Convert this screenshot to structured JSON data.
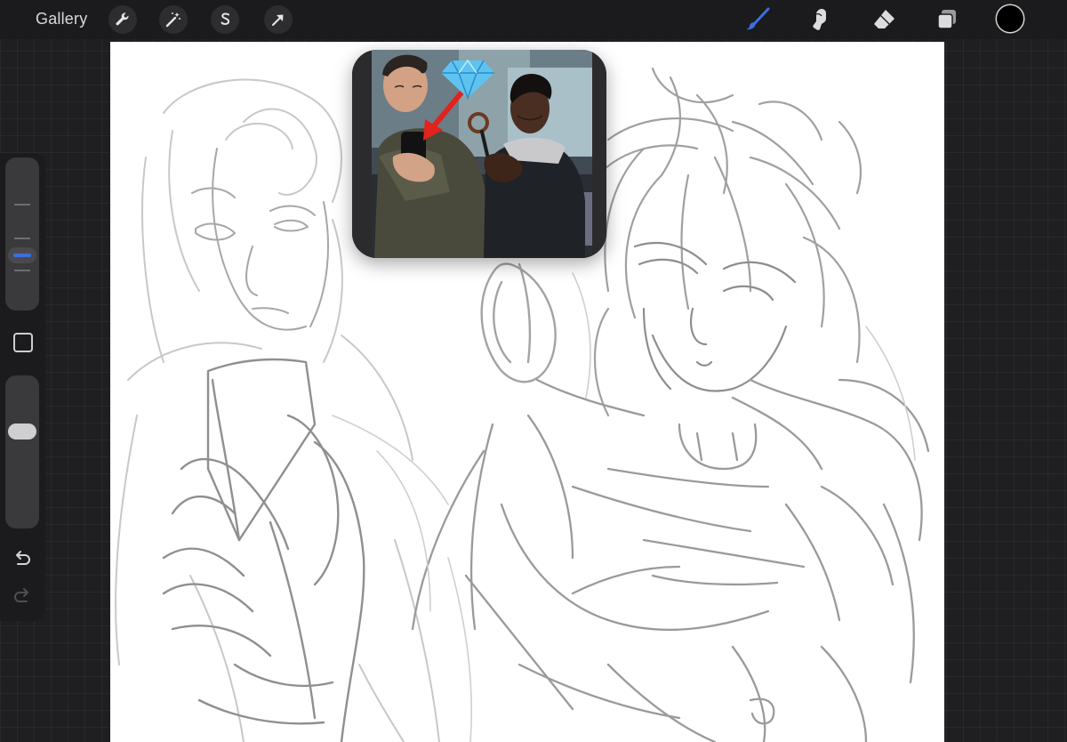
{
  "topbar": {
    "gallery_label": "Gallery",
    "left_tools": [
      {
        "name": "actions-wrench-icon"
      },
      {
        "name": "adjustments-wand-icon"
      },
      {
        "name": "selection-s-icon"
      },
      {
        "name": "transform-arrow-icon"
      }
    ],
    "right_tools": [
      {
        "name": "brush-icon",
        "active": true
      },
      {
        "name": "smudge-icon",
        "active": false
      },
      {
        "name": "eraser-icon",
        "active": false
      },
      {
        "name": "layers-icon",
        "active": false
      }
    ],
    "current_color": "#000000",
    "accent_color": "#3b6fe0"
  },
  "sidebar": {
    "brush_size_level": 0.35,
    "opacity_level": 0.3,
    "tools": [
      "modify-square-icon",
      "undo-icon",
      "redo-icon"
    ]
  },
  "reference_window": {
    "description_icons": [
      "diamond-emoji-icon",
      "red-arrow-icon",
      "magnifying-glass-icon"
    ]
  }
}
